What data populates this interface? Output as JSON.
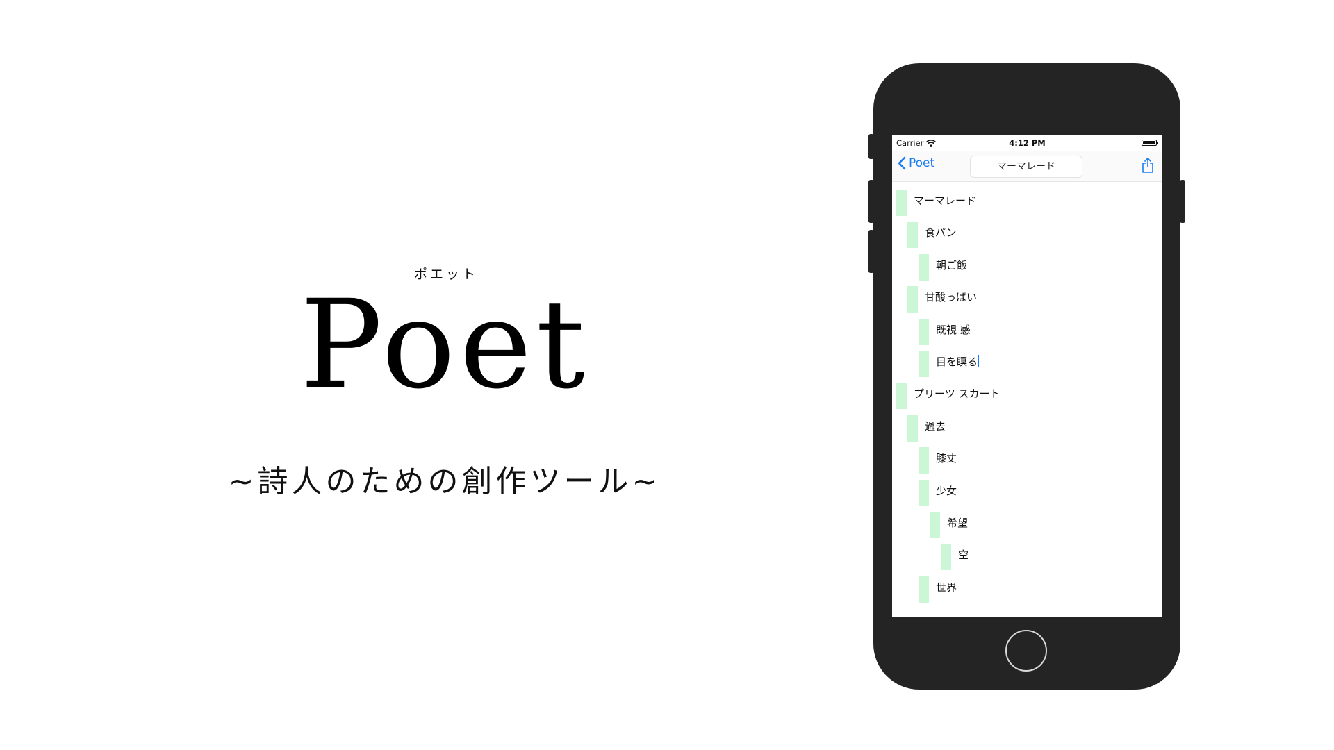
{
  "hero": {
    "ruby": "ポエット",
    "title": "Poet",
    "tagline": "~詩人のための創作ツール~"
  },
  "status_bar": {
    "carrier": "Carrier",
    "time": "4:12 PM"
  },
  "nav_bar": {
    "back_label": "Poet",
    "title_field_value": "マーマレード"
  },
  "outline": [
    {
      "text": "マーマレード",
      "level": 0
    },
    {
      "text": "食パン",
      "level": 1
    },
    {
      "text": "朝ご飯",
      "level": 2
    },
    {
      "text": "甘酸っぱい",
      "level": 1
    },
    {
      "text": "既視 感",
      "level": 2
    },
    {
      "text": "目を瞑る",
      "level": 2,
      "editing": true
    },
    {
      "text": "プリーツ スカート",
      "level": 0
    },
    {
      "text": "過去",
      "level": 1
    },
    {
      "text": "膝丈",
      "level": 2
    },
    {
      "text": "少女",
      "level": 2
    },
    {
      "text": "希望",
      "level": 3
    },
    {
      "text": "空",
      "level": 4
    },
    {
      "text": "世界",
      "level": 2
    }
  ],
  "colors": {
    "accent": "#1a7cf5",
    "indent_bar": "#ccf7d6",
    "phone_body": "#242424"
  }
}
